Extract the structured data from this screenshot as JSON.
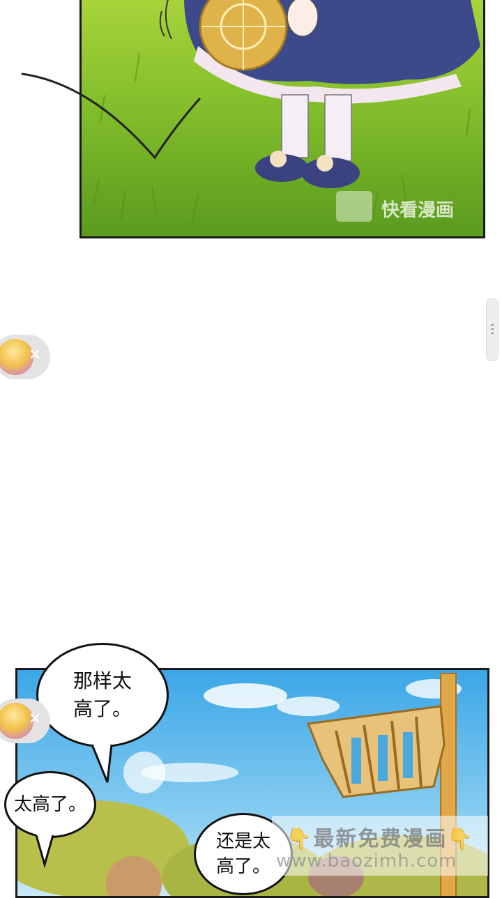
{
  "top_panel": {
    "watermark": "快看漫画"
  },
  "float_widget": {
    "close_glyph": "✕"
  },
  "bubbles": {
    "b1": "那样太\n高了。",
    "b2": "太高了。",
    "b3": "还是太\n高了。"
  },
  "site_watermark": {
    "line1": "👇最新免费漫画👇",
    "line2": "www.baozimh.com"
  }
}
